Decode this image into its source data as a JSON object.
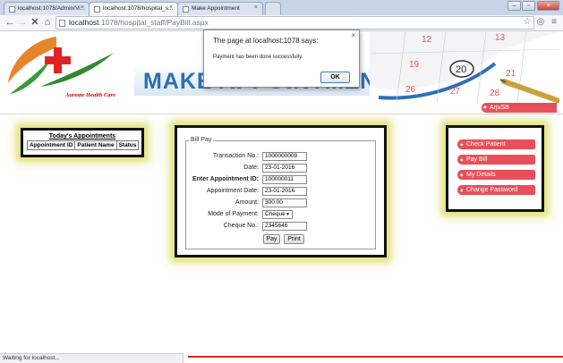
{
  "browser": {
    "tabs": [
      {
        "label": "localhost:1078/Admin/Vi..."
      },
      {
        "label": "localhost:1078/hospital_s..."
      },
      {
        "label": "Make Appointment"
      }
    ],
    "url_host": "localhost",
    "url_path": ":1078/hospital_staff/PayBill.aspx",
    "status_text": "Waiting for localhost..."
  },
  "header": {
    "logo_caption": "Aureate Health Care",
    "banner_title": "MAKE APPOINTMENT",
    "calendar_numbers": [
      "12",
      "13",
      "19",
      "20",
      "21",
      "26",
      "27",
      "28"
    ]
  },
  "user": {
    "name": "ArjuSB"
  },
  "appointments": {
    "title": "Today's Appointments",
    "columns": [
      "Appointment ID",
      "Patient Name",
      "Status"
    ]
  },
  "bill_pay": {
    "legend": "Bill Pay",
    "fields": [
      {
        "label": "Transaction No.:",
        "value": "1000000009"
      },
      {
        "label": "Date:",
        "value": "23-01-2016"
      },
      {
        "label": "Enter Appointment ID:",
        "value": "100000011"
      },
      {
        "label": "Appointment Date:",
        "value": "23-01-2016"
      },
      {
        "label": "Amount:",
        "value": "300.00"
      },
      {
        "label": "Mode of Payment:",
        "value": "Cheque"
      },
      {
        "label": "Cheque No.:",
        "value": "2345646"
      }
    ],
    "pay_label": "Pay",
    "print_label": "Print"
  },
  "menu": {
    "items": [
      {
        "label": "Check Patient"
      },
      {
        "label": "Pay Bill"
      },
      {
        "label": "My Details"
      },
      {
        "label": "Change Password"
      }
    ]
  },
  "alert": {
    "title": "The page at localhost:1078 says:",
    "message": "Payment has been done successfully.",
    "ok_label": "OK"
  },
  "colors": {
    "accent_red": "#e84f5a",
    "banner_blue": "#2e6fb0",
    "panel_glow": "#e2e27a"
  }
}
